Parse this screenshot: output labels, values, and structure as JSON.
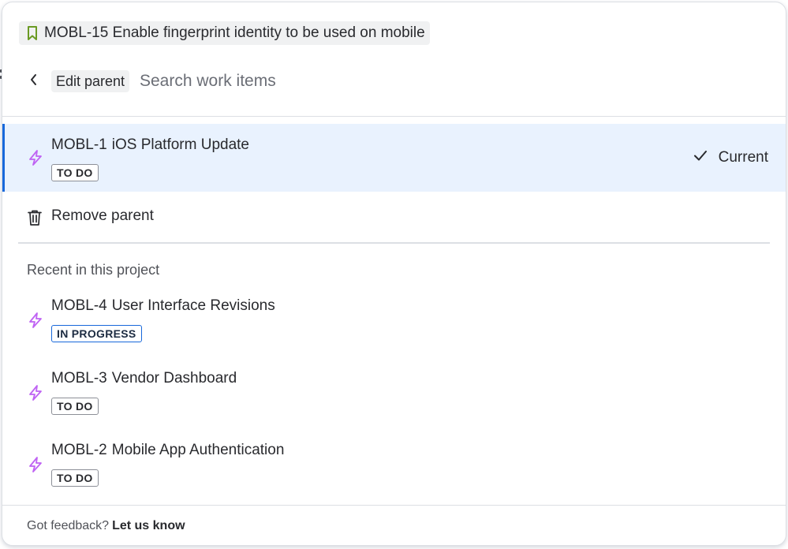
{
  "breadcrumb": {
    "icon": "bookmark-icon",
    "icon_color": "#6a9a23",
    "text": "MOBL-15 Enable fingerprint identity to be used on mobile"
  },
  "header": {
    "back_icon": "chevron-left-icon",
    "edit_label": "Edit parent",
    "search_placeholder": "Search work items"
  },
  "current_parent": {
    "key": "MOBL-1",
    "title": "iOS Platform Update",
    "status": "TO DO",
    "icon": "lightning-icon",
    "icon_color": "#bf63f3",
    "current_label": "Current",
    "check_icon": "check-icon"
  },
  "remove_parent": {
    "icon": "trash-icon",
    "label": "Remove parent"
  },
  "recent": {
    "section_label": "Recent in this project",
    "items": [
      {
        "key": "MOBL-4",
        "title": "User Interface Revisions",
        "status": "IN PROGRESS",
        "icon": "lightning-icon"
      },
      {
        "key": "MOBL-3",
        "title": "Vendor Dashboard",
        "status": "TO DO",
        "icon": "lightning-icon"
      },
      {
        "key": "MOBL-2",
        "title": "Mobile App Authentication",
        "status": "TO DO",
        "icon": "lightning-icon"
      }
    ]
  },
  "footer": {
    "prompt": "Got feedback?",
    "link": "Let us know"
  },
  "colors": {
    "selected_bg": "#e9f2fe",
    "selected_border": "#1868db",
    "in_progress_border": "#1868db"
  }
}
